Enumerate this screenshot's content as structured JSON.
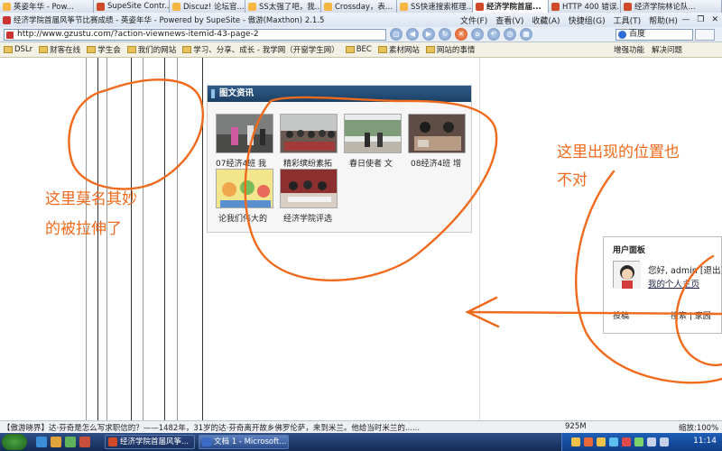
{
  "tabs": [
    {
      "label": "英姿年华 - Pow..."
    },
    {
      "label": "SupeSite Contr..."
    },
    {
      "label": "Discuz! 论坛官..."
    },
    {
      "label": "SS太强了吧，我..."
    },
    {
      "label": "Crossday，表..."
    },
    {
      "label": "SS快速搜索框理..."
    },
    {
      "label": "经济学院首届..."
    },
    {
      "label": "HTTP 400 错误..."
    },
    {
      "label": "经济学院林论队..."
    }
  ],
  "window": {
    "title": "经济学院首届风筝节比赛成绩 - 英姿年华 - Powered by SupeSite - 傲游(Maxthon) 2.1.5",
    "menus": [
      "文件(F)",
      "查看(V)",
      "收藏(A)",
      "快捷组(G)",
      "工具(T)",
      "帮助(H)"
    ]
  },
  "address": {
    "url": "http://www.gzustu.com/?action-viewnews-itemid-43-page-2"
  },
  "search": {
    "value": "百度"
  },
  "favorites": [
    "DSLr",
    "财客在线",
    "学生会",
    "我们的网站",
    "学习、分享、成长 - 我学网（开窗学生网）",
    "BEC",
    "素材网站",
    "网站的事情"
  ],
  "favorites_right": [
    "增强功能",
    "解决问题"
  ],
  "panel": {
    "title": "图文资讯",
    "items": [
      {
        "caption": "07经济4班 我"
      },
      {
        "caption": "精彩缤纷素拓"
      },
      {
        "caption": "春日使者 文"
      },
      {
        "caption": "08经济4班 增"
      },
      {
        "caption": "论我们伟大的"
      },
      {
        "caption": "经济学院评选"
      }
    ]
  },
  "user_panel": {
    "title": "用户面板",
    "greeting": "您好, admin [退出]",
    "profile_link": "我的个人主页",
    "post_link": "投稿",
    "links": "搜索 | 家园"
  },
  "annotations": {
    "left_line1": "这里莫名其妙",
    "left_line2": "的被拉伸了",
    "right_line1": "这里出现的位置也",
    "right_line2": "不对"
  },
  "status": {
    "message": "【傲游晓界】达·芬奇是怎么写求职信的？——1482年，31岁的达·芬奇离开故乡佛罗伦萨，来到米兰。他给当时米兰的......",
    "memory": "925M",
    "zoom": "缩放:100%"
  },
  "taskbar": {
    "tasks": [
      {
        "label": "经济学院首届风筝..."
      },
      {
        "label": "文档 1 - Microsoft..."
      }
    ],
    "clock": "11:14"
  },
  "colors": {
    "annotation": "#ef6a1c",
    "panel_header": "#2e5c89",
    "taskbar": "#1f3d73"
  }
}
